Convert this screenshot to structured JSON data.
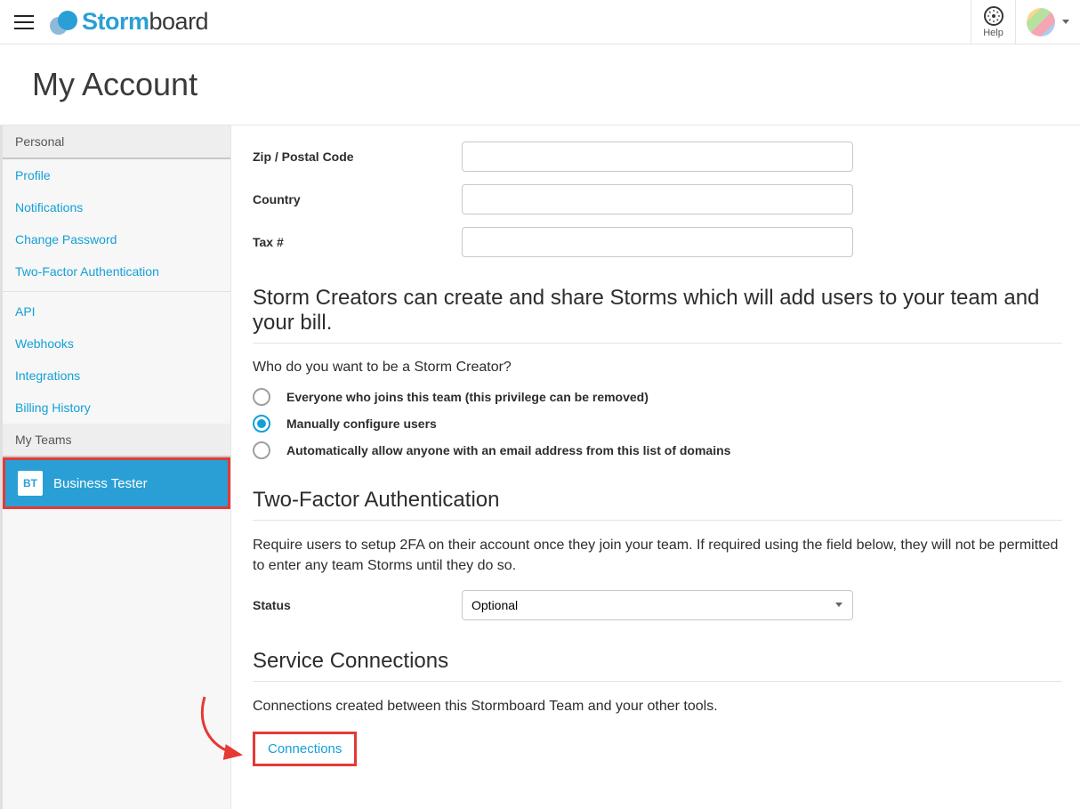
{
  "topbar": {
    "logo_bold": "Storm",
    "logo_rest": "board",
    "help_label": "Help"
  },
  "page_title": "My Account",
  "sidebar": {
    "personal_header": "Personal",
    "links_personal": [
      "Profile",
      "Notifications",
      "Change Password",
      "Two-Factor Authentication"
    ],
    "links_extra": [
      "API",
      "Webhooks",
      "Integrations",
      "Billing History"
    ],
    "myteams_header": "My Teams",
    "team": {
      "badge": "BT",
      "label": "Business Tester"
    }
  },
  "form": {
    "zip_label": "Zip / Postal Code",
    "country_label": "Country",
    "tax_label": "Tax #",
    "zip_value": "",
    "country_value": "",
    "tax_value": ""
  },
  "creators": {
    "heading": "Storm Creators can create and share Storms which will add users to your team and your bill.",
    "question": "Who do you want to be a Storm Creator?",
    "opt1": "Everyone who joins this team (this privilege can be removed)",
    "opt2": "Manually configure users",
    "opt3": "Automatically allow anyone with an email address from this list of domains"
  },
  "tfa": {
    "heading": "Two-Factor Authentication",
    "body": "Require users to setup 2FA on their account once they join your team. If required using the field below, they will not be permitted to enter any team Storms until they do so.",
    "status_label": "Status",
    "status_value": "Optional"
  },
  "connections": {
    "heading": "Service Connections",
    "body": "Connections created between this Stormboard Team and your other tools.",
    "button": "Connections"
  }
}
